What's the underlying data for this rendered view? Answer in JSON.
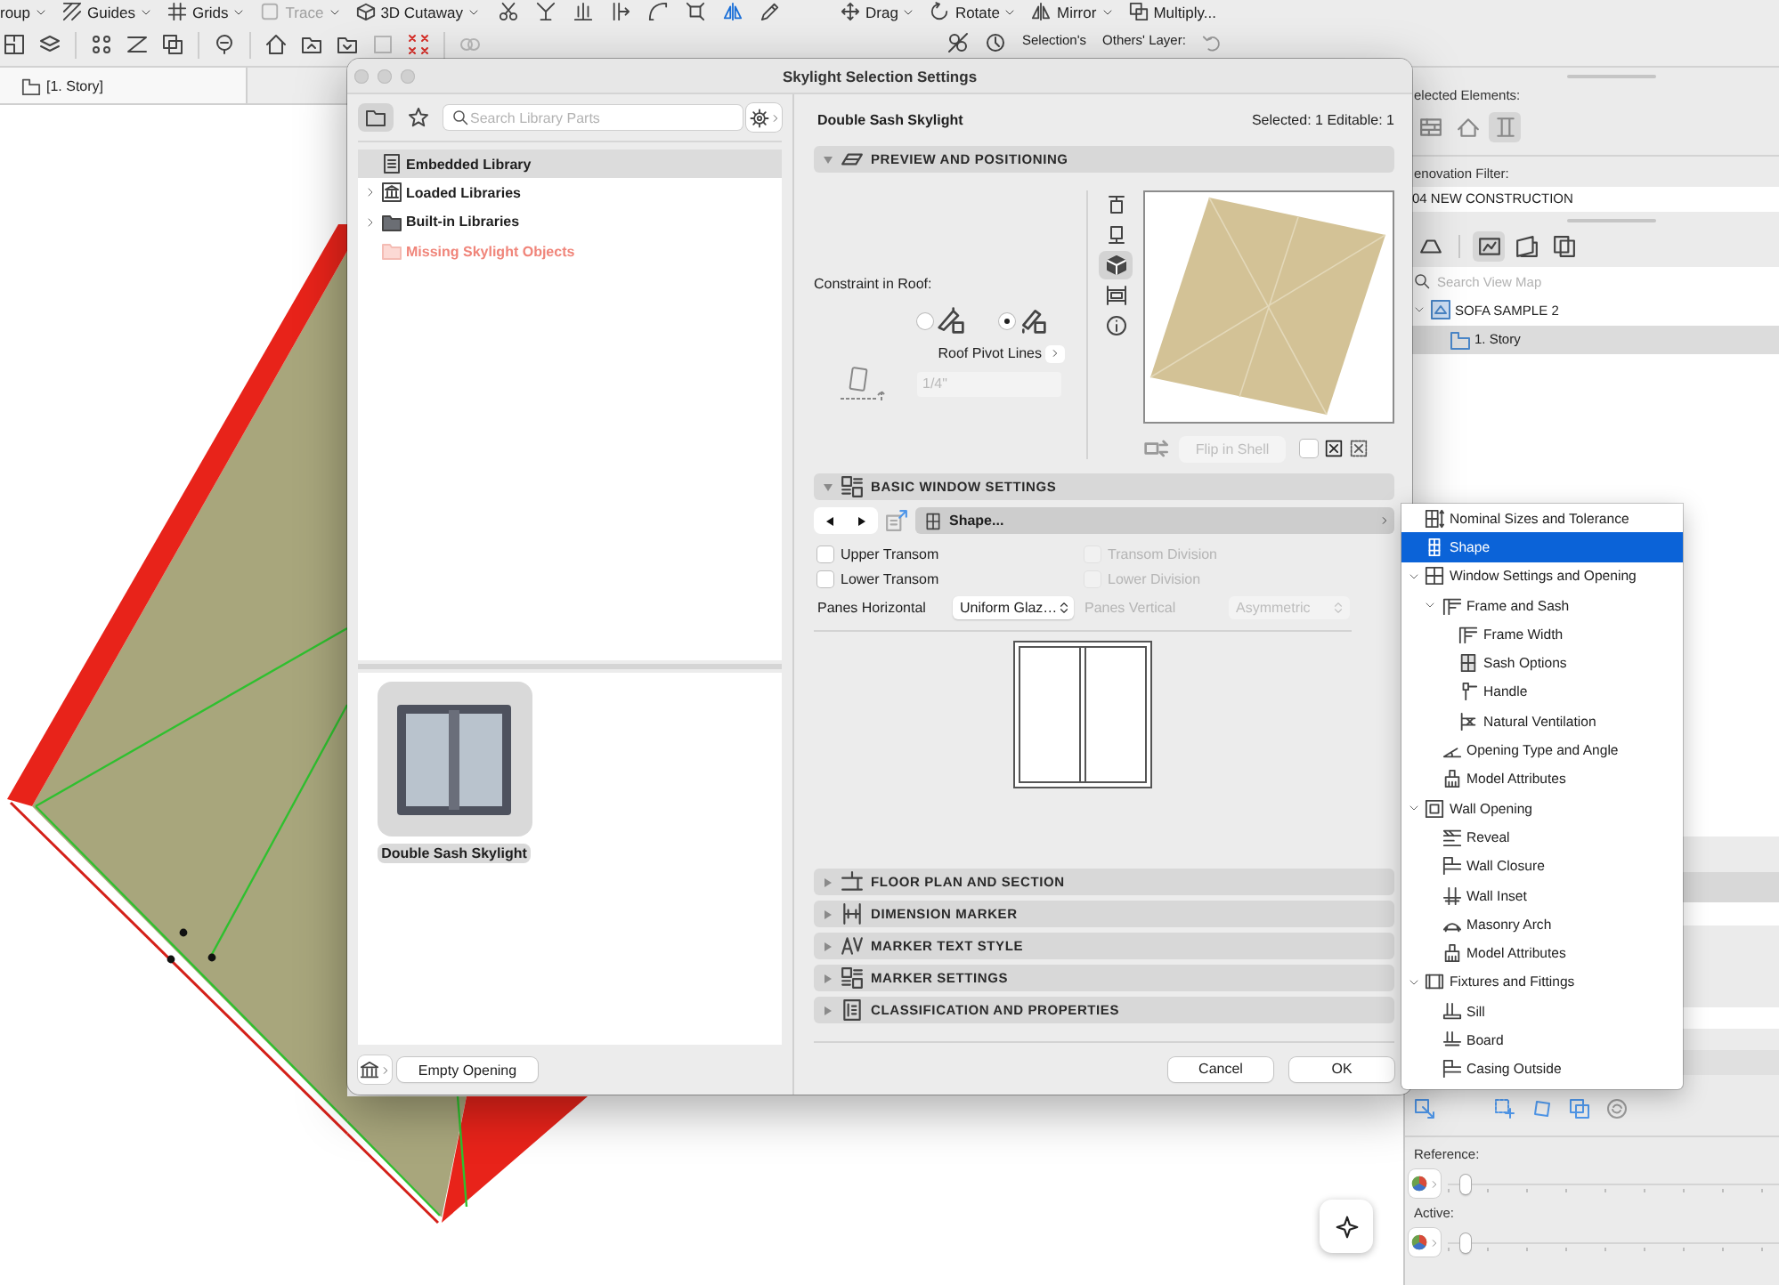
{
  "toolbar": {
    "tools": [
      {
        "label": "roup",
        "disabled": false
      },
      {
        "label": "Guides",
        "disabled": false
      },
      {
        "label": "Grids",
        "disabled": false
      },
      {
        "label": "Trace",
        "disabled": true
      },
      {
        "label": "3D Cutaway",
        "disabled": false
      },
      {
        "label": "Drag",
        "disabled": false
      },
      {
        "label": "Rotate",
        "disabled": false
      },
      {
        "label": "Mirror",
        "disabled": false
      },
      {
        "label": "Multiply...",
        "disabled": false
      }
    ],
    "selection_label": "Selection's",
    "others_layer_label": "Others' Layer:"
  },
  "view_tabs": [
    {
      "label": "[1. Story]"
    }
  ],
  "navigator": {
    "selected_elements_label": "elected Elements:",
    "element_types": [
      {
        "selected": false
      },
      {
        "selected": false
      },
      {
        "selected": true
      }
    ],
    "renovation_filter_label": "enovation Filter:",
    "renovation_filter": "04 NEW CONSTRUCTION",
    "map_modes": [
      {
        "selected": false
      },
      {
        "selected": true
      },
      {
        "selected": false
      },
      {
        "selected": false
      }
    ],
    "search": {
      "placeholder": "Search View Map"
    },
    "tree": [
      {
        "label": "SOFA SAMPLE 2",
        "selected": false,
        "expanded": true,
        "children": [
          {
            "label": "1. Story",
            "selected": true
          }
        ]
      }
    ]
  },
  "layer_panel": {
    "reference_label": "Reference:",
    "reference": {
      "level": 0.04
    },
    "active_label": "Active:",
    "active": {
      "level": 0.04
    }
  },
  "dialog": {
    "title": "Skylight Selection Settings",
    "library": {
      "view_tabs": [
        {
          "selected": true
        },
        {
          "selected": false
        }
      ],
      "search": {
        "placeholder": "Search Library Parts"
      },
      "folders": [
        {
          "label": "Embedded Library",
          "kind": "embedded",
          "selected": true
        },
        {
          "label": "Loaded Libraries",
          "kind": "loaded",
          "selected": false,
          "expanded": false
        },
        {
          "label": "Built-in Libraries",
          "kind": "builtin",
          "selected": false,
          "expanded": false
        },
        {
          "label": "Missing Skylight Objects",
          "kind": "missing",
          "selected": false
        }
      ],
      "objects": [
        {
          "label": "Double Sash Skylight",
          "selected": true
        }
      ],
      "empty_opening_button": "Empty Opening"
    },
    "object_name": "Double Sash Skylight",
    "selection_status": "Selected: 1 Editable: 1",
    "sections": [
      {
        "kind": "preview",
        "title": "PREVIEW AND POSITIONING",
        "expanded": true,
        "constraint_label": "Constraint in Roof:",
        "constraint_options": [
          {
            "selected": false
          },
          {
            "selected": true
          }
        ],
        "pivot_label": "Roof Pivot Lines",
        "pivot_field": {
          "value": "1/4\"",
          "disabled": true
        },
        "view_modes": [
          {
            "selected": false
          },
          {
            "selected": false
          },
          {
            "selected": true
          },
          {
            "selected": false
          },
          {
            "selected": false
          }
        ],
        "flip_button": {
          "label": "Flip in Shell",
          "disabled": true
        },
        "flip_checkbox": {
          "checked": false
        }
      },
      {
        "kind": "basic",
        "title": "BASIC WINDOW SETTINGS",
        "expanded": true,
        "page": "Shape...",
        "checkboxes": [
          {
            "label": "Upper Transom",
            "checked": false,
            "disabled": false
          },
          {
            "label": "Transom Division",
            "checked": false,
            "disabled": true
          },
          {
            "label": "Lower Transom",
            "checked": false,
            "disabled": false
          },
          {
            "label": "Lower Division",
            "checked": false,
            "disabled": true
          }
        ],
        "panes": [
          {
            "label": "Panes Horizontal",
            "value": "Uniform Glaz…",
            "disabled": false
          },
          {
            "label": "Panes Vertical",
            "value": "Asymmetric",
            "disabled": true
          }
        ]
      },
      {
        "kind": "floor_plan",
        "title": "FLOOR PLAN AND SECTION",
        "expanded": false
      },
      {
        "kind": "dimension",
        "title": "DIMENSION MARKER",
        "expanded": false
      },
      {
        "kind": "marker_text",
        "title": "MARKER TEXT STYLE",
        "expanded": false
      },
      {
        "kind": "marker_settings",
        "title": "MARKER SETTINGS",
        "expanded": false
      },
      {
        "kind": "classification",
        "title": "CLASSIFICATION AND PROPERTIES",
        "expanded": false
      }
    ],
    "buttons": [
      "Cancel",
      "OK"
    ]
  },
  "page_menu": {
    "items": [
      {
        "label": "Nominal Sizes and Tolerance",
        "selected": false
      },
      {
        "label": "Shape",
        "selected": true
      },
      {
        "label": "Window Settings and Opening",
        "selected": false,
        "expanded": true,
        "children": [
          {
            "label": "Frame and Sash",
            "selected": false,
            "expanded": true,
            "children": [
              {
                "label": "Frame Width",
                "selected": false
              },
              {
                "label": "Sash Options",
                "selected": false
              },
              {
                "label": "Handle",
                "selected": false
              },
              {
                "label": "Natural Ventilation",
                "selected": false
              }
            ]
          },
          {
            "label": "Opening Type and Angle",
            "selected": false
          },
          {
            "label": "Model Attributes",
            "selected": false
          }
        ]
      },
      {
        "label": "Wall Opening",
        "selected": false,
        "expanded": true,
        "children": [
          {
            "label": "Reveal",
            "selected": false
          },
          {
            "label": "Wall Closure",
            "selected": false
          },
          {
            "label": "Wall Inset",
            "selected": false
          },
          {
            "label": "Masonry Arch",
            "selected": false
          },
          {
            "label": "Model Attributes",
            "selected": false
          }
        ]
      },
      {
        "label": "Fixtures and Fittings",
        "selected": false,
        "expanded": true,
        "children": [
          {
            "label": "Sill",
            "selected": false
          },
          {
            "label": "Board",
            "selected": false
          },
          {
            "label": "Casing Outside",
            "selected": false
          }
        ]
      }
    ]
  }
}
